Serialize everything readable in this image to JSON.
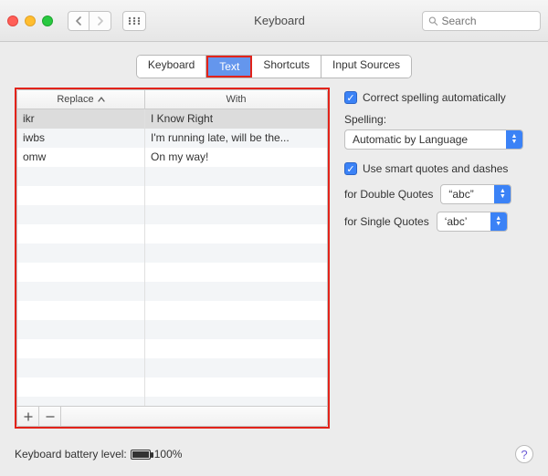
{
  "window": {
    "title": "Keyboard"
  },
  "search": {
    "placeholder": "Search"
  },
  "tabs": {
    "keyboard": "Keyboard",
    "text": "Text",
    "shortcuts": "Shortcuts",
    "input_sources": "Input Sources"
  },
  "table": {
    "columns": {
      "replace": "Replace",
      "with": "With"
    },
    "rows": [
      {
        "replace": "ikr",
        "with": "I Know Right"
      },
      {
        "replace": "iwbs",
        "with": "I'm running late, will be the..."
      },
      {
        "replace": "omw",
        "with": "On my way!"
      }
    ]
  },
  "options": {
    "correct_spelling_label": "Correct spelling automatically",
    "correct_spelling_checked": true,
    "spelling_label": "Spelling:",
    "spelling_value": "Automatic by Language",
    "smart_quotes_label": "Use smart quotes and dashes",
    "smart_quotes_checked": true,
    "double_quotes_label": "for Double Quotes",
    "double_quotes_value": "“abc”",
    "single_quotes_label": "for Single Quotes",
    "single_quotes_value": "‘abc’"
  },
  "battery": {
    "label": "Keyboard battery level:",
    "percent": "100%"
  }
}
